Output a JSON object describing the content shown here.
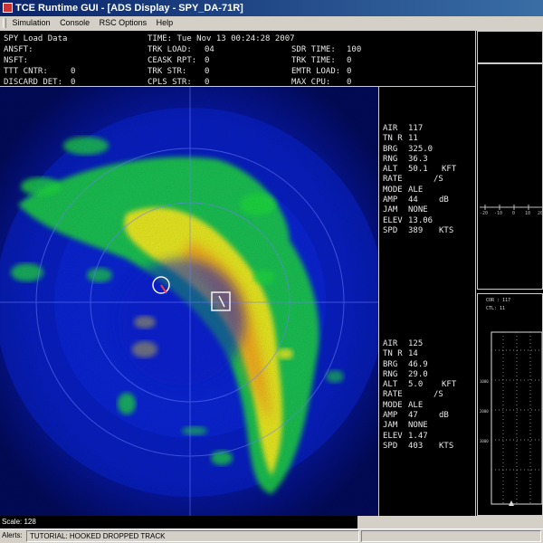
{
  "window": {
    "title": "TCE Runtime GUI - [ADS Display - SPY_DA-71R]"
  },
  "menu": [
    "Simulation",
    "Console",
    "RSC Options",
    "Help"
  ],
  "status_header": {
    "spy_load_data": "SPY Load Data",
    "ansft": "ANSFT:",
    "nsft": "NSFT:",
    "ttt_cntr": "TTT CNTR:",
    "ttt_cntr_value": "0",
    "discard_det": "DISCARD DET:",
    "discard_det_value": "0",
    "time": "TIME: Tue Nov 13 00:24:28 2007",
    "trk_load": "TRK LOAD:",
    "trk_load_value": "04",
    "ceask_rpt": "CEASK RPT:",
    "ceask_rpt_value": "0",
    "trk_str": "TRK STR:",
    "trk_str_value": "0",
    "cpls_str": "CPLS STR:",
    "cpls_str_value": "0",
    "sdr_time": "SDR TIME:",
    "sdr_time_value": "100",
    "trk_time": "TRK TIME:",
    "trk_time_value": "0",
    "emtr_load": "EMTR LOAD:",
    "emtr_load_value": "0",
    "max_cpu": "MAX CPU:",
    "max_cpu_value": "0"
  },
  "track_panels": [
    {
      "rows": [
        {
          "label": "AIR",
          "value": "117",
          "unit": ""
        },
        {
          "label": "TN R",
          "value": "11",
          "unit": ""
        },
        {
          "label": "BRG",
          "value": "325.0",
          "unit": ""
        },
        {
          "label": "RNG",
          "value": "36.3",
          "unit": ""
        },
        {
          "label": "ALT",
          "value": "50.1",
          "unit": "KFT"
        },
        {
          "label": "RATE",
          "value": "",
          "unit": "/S"
        },
        {
          "label": "MODE",
          "value": "ALE",
          "unit": ""
        },
        {
          "label": "AMP",
          "value": "44",
          "unit": "dB"
        },
        {
          "label": "JAM",
          "value": "NONE",
          "unit": ""
        },
        {
          "label": "ELEV",
          "value": "13.06",
          "unit": ""
        },
        {
          "label": "SPD",
          "value": "389",
          "unit": "KTS"
        }
      ]
    },
    {
      "rows": [
        {
          "label": "AIR",
          "value": "125",
          "unit": ""
        },
        {
          "label": "TN R",
          "value": "14",
          "unit": ""
        },
        {
          "label": "BRG",
          "value": "46.9",
          "unit": ""
        },
        {
          "label": "RNG",
          "value": "29.0",
          "unit": ""
        },
        {
          "label": "ALT",
          "value": "5.0",
          "unit": "KFT"
        },
        {
          "label": "RATE",
          "value": "",
          "unit": "/S"
        },
        {
          "label": "MODE",
          "value": "ALE",
          "unit": ""
        },
        {
          "label": "AMP",
          "value": "47",
          "unit": "dB"
        },
        {
          "label": "JAM",
          "value": "NONE",
          "unit": ""
        },
        {
          "label": "ELEV",
          "value": "1.47",
          "unit": ""
        },
        {
          "label": "SPD",
          "value": "403",
          "unit": "KTS"
        }
      ]
    }
  ],
  "right_plot": {
    "axis_labels": [
      "-20",
      "-10",
      "0",
      "10",
      "20"
    ],
    "cor_label": "COR : 117",
    "ctl_label": "CTL: 11",
    "y_ticks": [
      "1000",
      "2000",
      "3000"
    ]
  },
  "scale": "Scale: 128",
  "alerts": {
    "label": "Alerts:",
    "message": "TUTORIAL: HOOKED DROPPED TRACK"
  },
  "colors": {
    "radar_blue": "#0a22d8",
    "radar_green": "#1fd03a",
    "radar_yellow": "#f2e21a",
    "radar_orange": "#e8941c",
    "title_blue": "#0a246a"
  }
}
